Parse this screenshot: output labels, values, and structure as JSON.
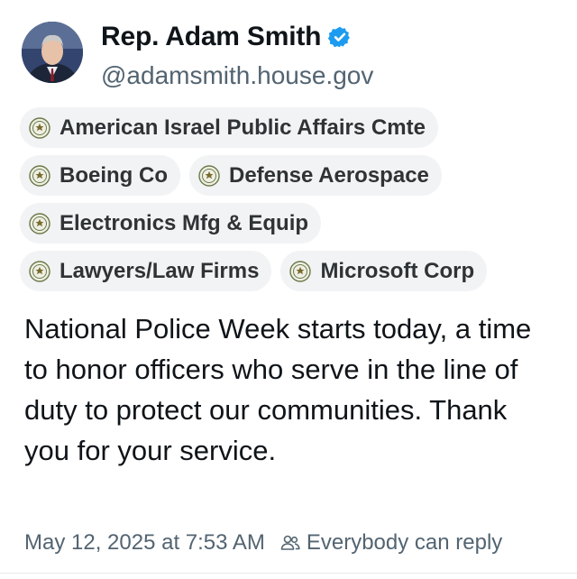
{
  "profile": {
    "name": "Rep. Adam Smith",
    "handle": "@adamsmith.house.gov",
    "verified": true,
    "verified_color": "#1d9bf0"
  },
  "donor_chips": [
    [
      "American Israel Public Affairs Cmte"
    ],
    [
      "Boeing Co",
      "Defense Aerospace"
    ],
    [
      "Electronics Mfg & Equip"
    ],
    [
      "Lawyers/Law Firms",
      "Microsoft Corp"
    ]
  ],
  "chip_icon": "seal-icon",
  "post": {
    "text": "National Police Week starts today, a time to honor officers who serve in the line of duty to protect our communities. Thank you for your service."
  },
  "meta": {
    "timestamp": "May 12, 2025 at 7:53 AM",
    "reply_setting": "Everybody can reply",
    "reply_icon": "people-icon"
  }
}
